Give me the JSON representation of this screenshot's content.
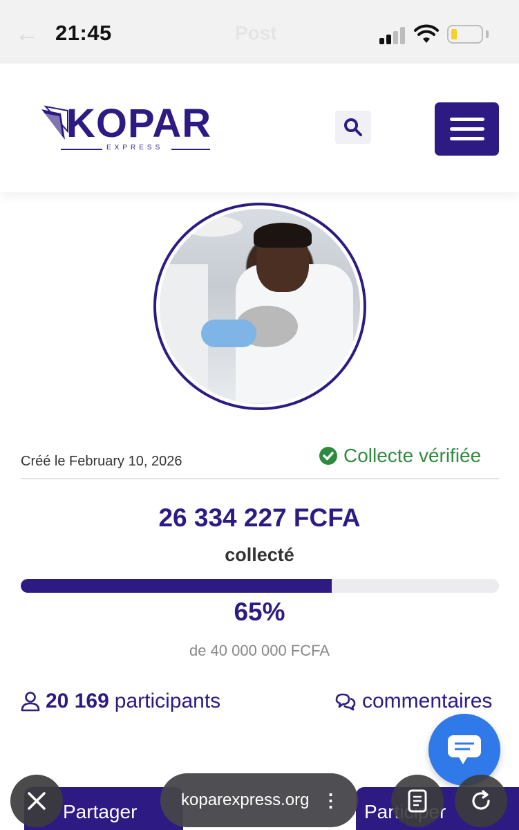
{
  "status_bar": {
    "time": "21:45",
    "title": "Post",
    "back_glyph": "←",
    "signal_bars": 4,
    "signal_active": 2,
    "battery_level": 0.15
  },
  "header": {
    "logo_text": "KOPAR",
    "logo_subtext": "EXPRESS",
    "search_icon": "search-icon",
    "menu_icon": "hamburger-icon"
  },
  "campaign": {
    "created": "Créé le February 10, 2026",
    "verified_label": "Collecte vérifiée",
    "amount": "26 334 227 FCFA",
    "collected_label": "collecté",
    "progress_fraction": 0.65,
    "percent": "65%",
    "goal": "de 40 000 000 FCFA",
    "participants_count": "20 169",
    "participants_label": "participants",
    "comments_label": "commentaires"
  },
  "bottom": {
    "share_left": "Partager",
    "share_right": "Participer",
    "url": "koparexpress.org",
    "url_menu": "⋮"
  },
  "colors": {
    "brand": "#2e1a83",
    "verified": "#2e8b3e",
    "chat": "#2f79e8"
  }
}
